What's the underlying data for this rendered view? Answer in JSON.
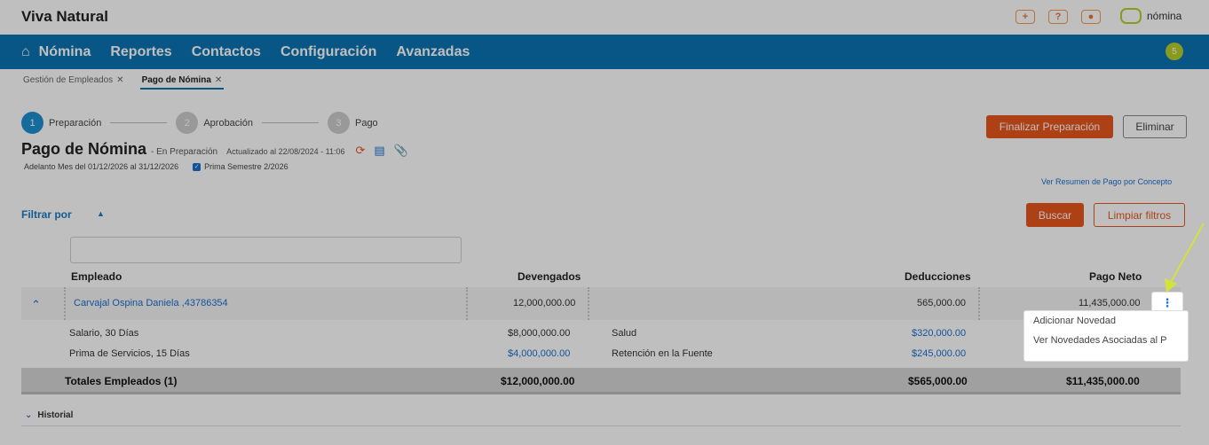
{
  "app": {
    "brand": "Viva Natural",
    "logo_text": "nómina"
  },
  "top_icons": [
    "+",
    "?",
    "●"
  ],
  "nav": {
    "items": [
      "Nómina",
      "Reportes",
      "Contactos",
      "Configuración",
      "Avanzadas"
    ],
    "badge": "5"
  },
  "tabs": [
    {
      "label": "Gestión de Empleados",
      "close": "✕"
    },
    {
      "label": "Pago de Nómina",
      "close": "✕"
    }
  ],
  "steps": [
    {
      "number": "1",
      "label": "Preparación"
    },
    {
      "number": "2",
      "label": "Aprobación"
    },
    {
      "number": "3",
      "label": "Pago"
    }
  ],
  "actions": {
    "finalize": "Finalizar Preparación",
    "delete": "Eliminar"
  },
  "header": {
    "title": "Pago de Nómina",
    "status": "- En Preparación",
    "updated": "Actualizado al 22/08/2024 - 11:06",
    "period": "Adelanto Mes del 01/12/2026 al 31/12/2026",
    "checkbox_label": "Prima Semestre 2/2026"
  },
  "summary_link": "Ver Resumen de Pago por Concepto",
  "filter": {
    "label": "Filtrar por",
    "search": "Buscar",
    "clear": "Limpiar filtros"
  },
  "table": {
    "headers": {
      "employee": "Empleado",
      "earned": "Devengados",
      "deductions": "Deducciones",
      "net": "Pago Neto"
    },
    "employee": {
      "name": "Carvajal Ospina Daniela ,43786354",
      "earned": "12,000,000.00",
      "deductions": "565,000.00",
      "net": "11,435,000.00"
    },
    "earned_items": [
      {
        "label": "Salario, 30 Días",
        "value": "$8,000,000.00"
      },
      {
        "label": "Prima de Servicios, 15 Días",
        "value": "$4,000,000.00"
      }
    ],
    "deduction_items": [
      {
        "label": "Salud",
        "value": "$320,000.00"
      },
      {
        "label": "Retención en la Fuente",
        "value": "$245,000.00"
      }
    ],
    "totals": {
      "label": "Totales Empleados (1)",
      "earned": "$12,000,000.00",
      "deductions": "$565,000.00",
      "net": "$11,435,000.00"
    }
  },
  "dropdown": [
    "Adicionar Novedad",
    "Ver Novedades Asociadas al P"
  ],
  "history": "Historial",
  "colors": {
    "primary": "#0b73b2",
    "accent": "#e8561e",
    "lime": "#b6cf2a"
  }
}
